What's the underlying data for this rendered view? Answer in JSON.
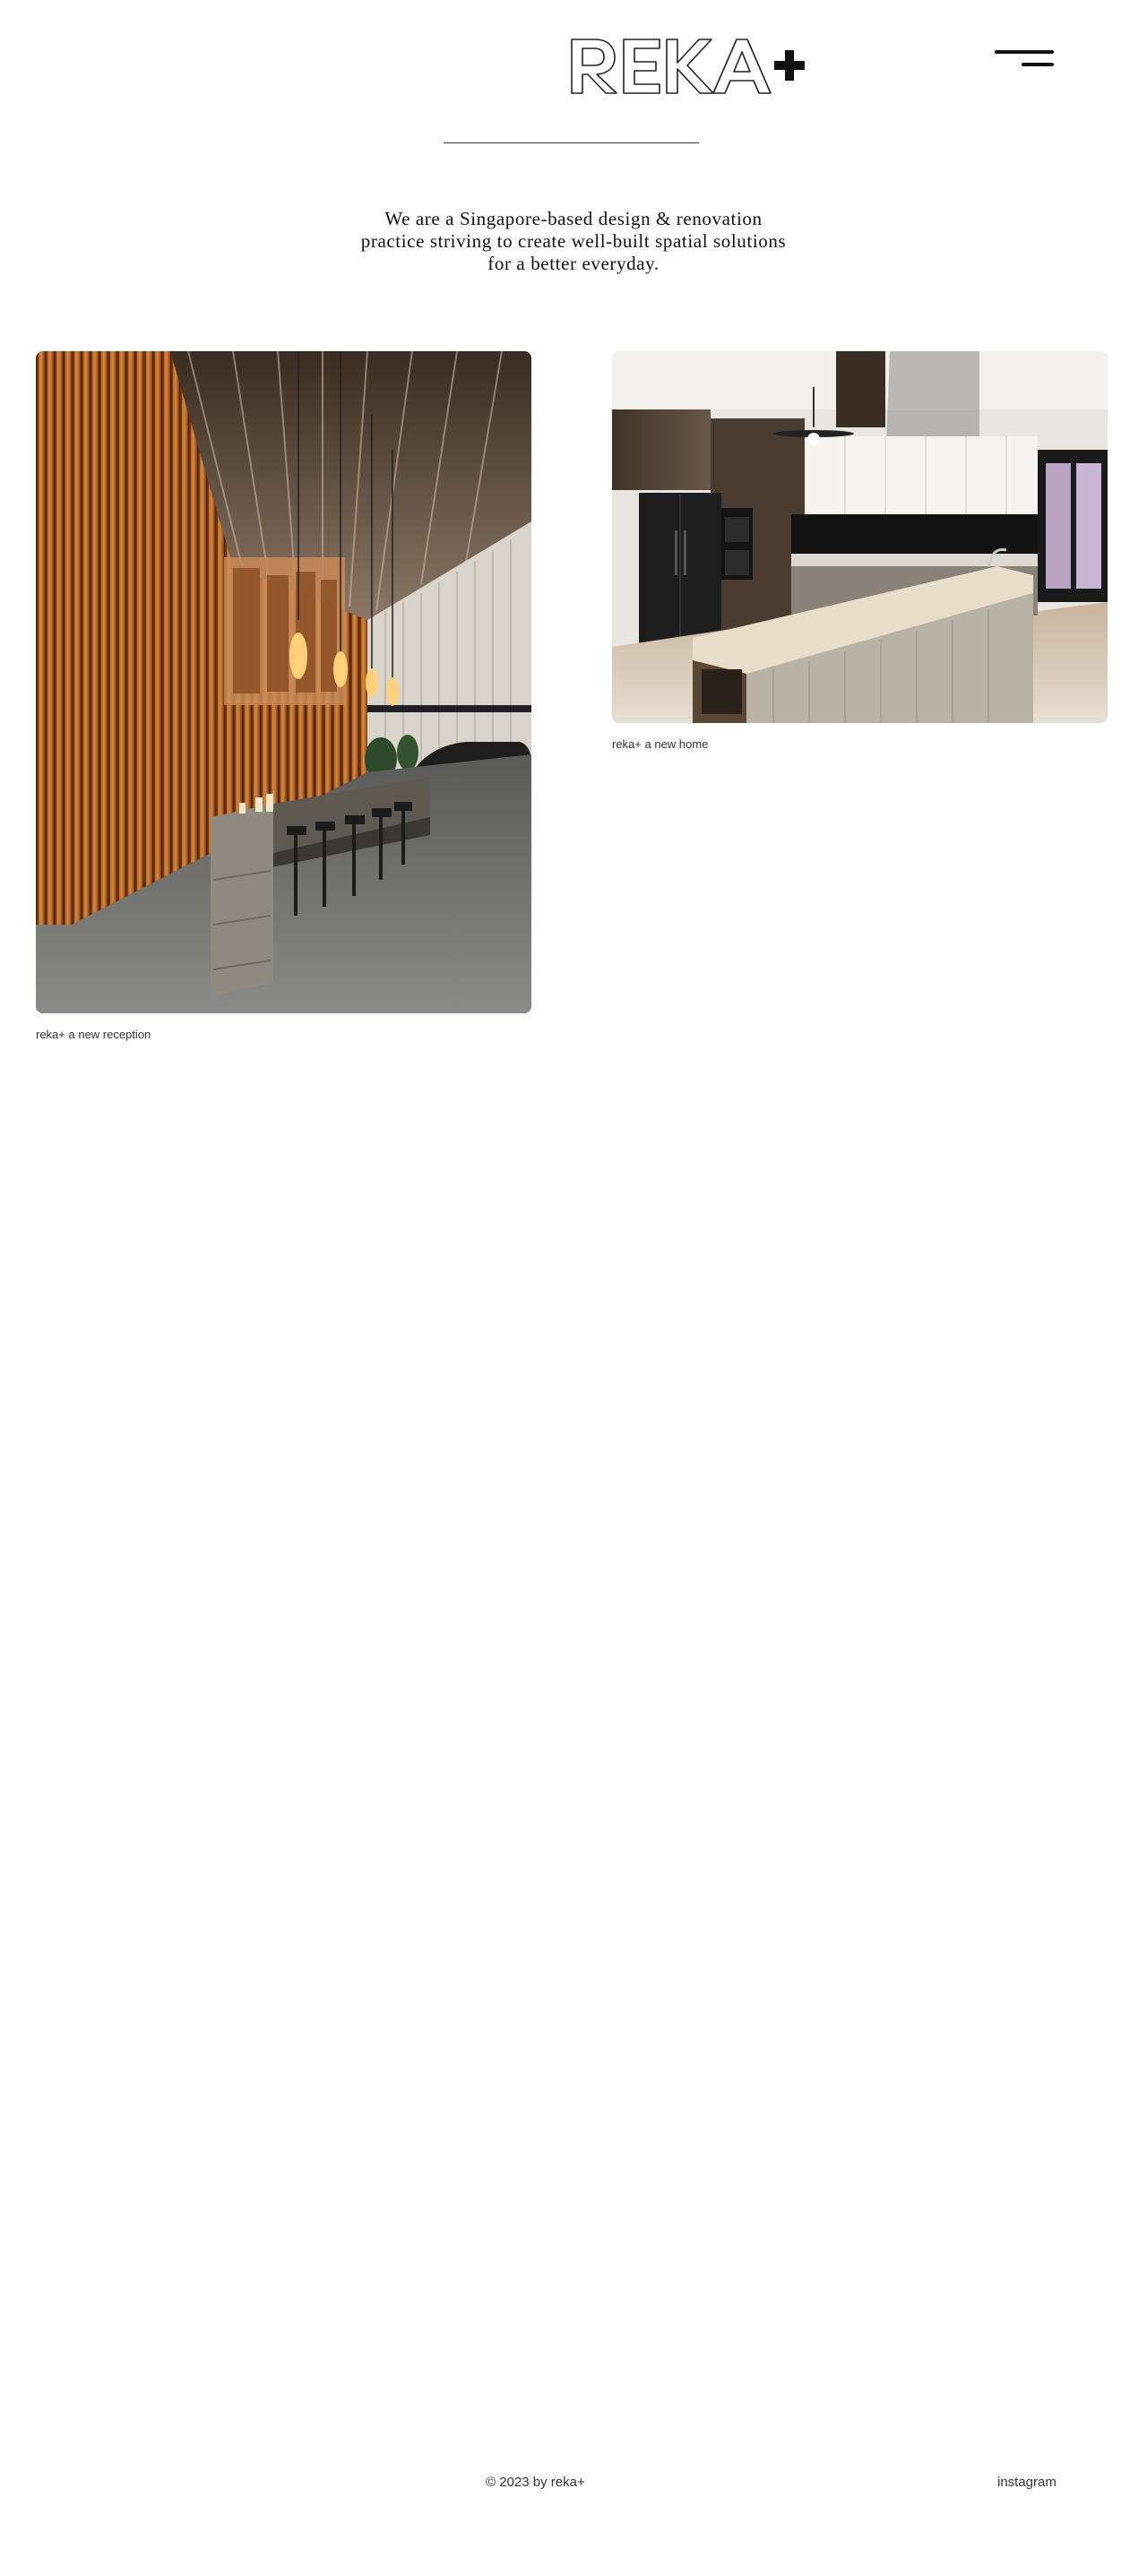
{
  "header": {
    "logo_text": "REKA+",
    "menu_icon": "hamburger-menu-icon"
  },
  "intro": {
    "line1": "We are a Singapore-based design & renovation",
    "line2": "practice striving to create well-built spatial solutions",
    "line3": "for a better everyday."
  },
  "projects": [
    {
      "caption": "reka+ a new reception",
      "image": "reception-interior-photo"
    },
    {
      "caption": "reka+ a new home",
      "image": "kitchen-interior-photo"
    }
  ],
  "footer": {
    "copyright": "© 2023 by reka+",
    "instagram_link": "instagram"
  },
  "colors": {
    "text": "#222222",
    "background": "#ffffff",
    "wood": "#a85a1c"
  }
}
